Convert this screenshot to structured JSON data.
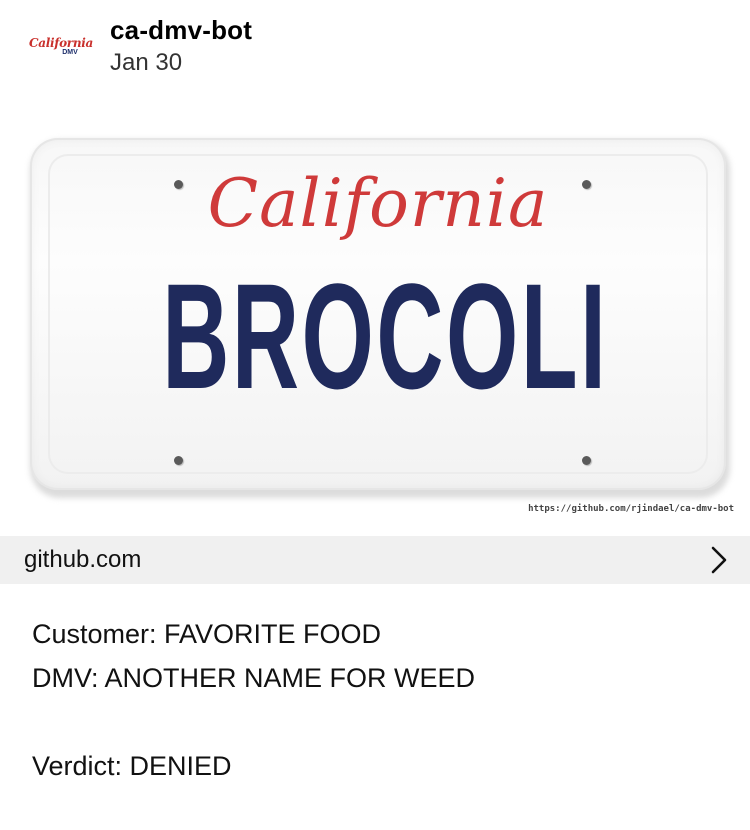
{
  "post": {
    "avatar": {
      "script_text": "California",
      "sub_text": "DMV"
    },
    "username": "ca-dmv-bot",
    "date": "Jan 30"
  },
  "link_card": {
    "plate": {
      "state_name": "California",
      "plate_text": "BROCOLI"
    },
    "image_caption": "https://github.com/rjindael/ca-dmv-bot",
    "domain": "github.com",
    "icon": "chevron-right-icon"
  },
  "body": {
    "line_customer": "Customer: FAVORITE FOOD",
    "line_dmv": "DMV: ANOTHER NAME FOR WEED",
    "line_verdict": "Verdict: DENIED"
  },
  "colors": {
    "plate_script_red": "#cf3a3a",
    "plate_text_navy": "#1f2a5c",
    "link_bar_bg": "#f0f0f0"
  }
}
